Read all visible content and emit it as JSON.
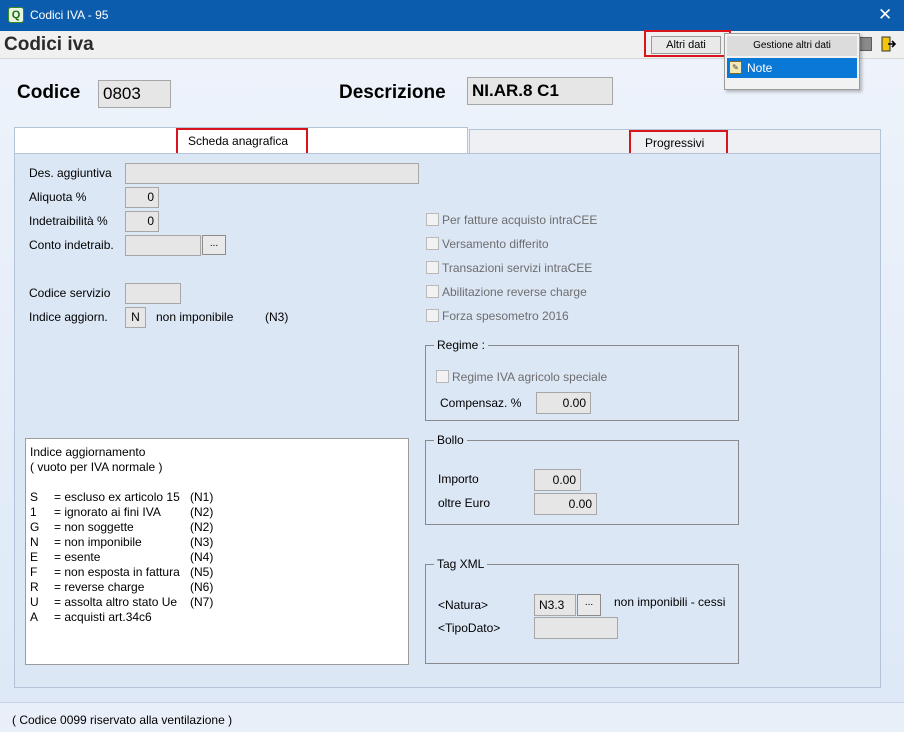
{
  "window": {
    "title": "Codici IVA - 95",
    "close_glyph": "✕",
    "app_icon": "Q"
  },
  "header": {
    "title": "Codici iva",
    "altri_dati_label": "Altri dati"
  },
  "popup_menu": {
    "header": "Gestione altri dati",
    "items": [
      {
        "label": "Note",
        "icon": "note-icon"
      }
    ]
  },
  "record": {
    "codice_label": "Codice",
    "codice_value": "0803",
    "descrizione_label": "Descrizione",
    "descrizione_value": "NI.AR.8 C1"
  },
  "tabs": [
    {
      "label": "Scheda anagrafica",
      "active": true
    },
    {
      "label": "Progressivi",
      "active": false
    }
  ],
  "form": {
    "des_aggiuntiva_label": "Des. aggiuntiva",
    "des_aggiuntiva_value": "",
    "aliquota_label": "Aliquota %",
    "aliquota_value": "0",
    "indetraibilita_label": "Indetraibilità %",
    "indetraibilita_value": "0",
    "conto_indetraib_label": "Conto indetraib.",
    "conto_indetraib_value": "",
    "ellipsis": "...",
    "codice_servizio_label": "Codice servizio",
    "codice_servizio_value": "",
    "indice_aggiorn_label": "Indice aggiorn.",
    "indice_aggiorn_value": "N",
    "indice_aggiorn_desc": "non imponibile",
    "indice_aggiorn_code": "(N3)"
  },
  "checkboxes": [
    {
      "label": "Per fatture acquisto intraCEE",
      "checked": false
    },
    {
      "label": "Versamento differito",
      "checked": false
    },
    {
      "label": "Transazioni servizi intraCEE",
      "checked": false
    },
    {
      "label": "Abilitazione reverse charge",
      "checked": false
    },
    {
      "label": "Forza spesometro 2016",
      "checked": false
    }
  ],
  "regime": {
    "title": "Regime :",
    "agricolo_label": "Regime IVA agricolo speciale",
    "compensaz_label": "Compensaz. %",
    "compensaz_value": "0.00"
  },
  "bollo": {
    "title": "Bollo",
    "importo_label": "Importo",
    "importo_value": "0.00",
    "oltre_label": "oltre Euro",
    "oltre_value": "0.00"
  },
  "tag_xml": {
    "title": "Tag XML",
    "natura_label": "<Natura>",
    "natura_value": "N3.3",
    "natura_desc": "non imponibili - cessi",
    "tipodato_label": "<TipoDato>",
    "tipodato_value": ""
  },
  "legend": {
    "title": "Indice aggiornamento",
    "subtitle": "( vuoto per IVA normale )",
    "rows": [
      {
        "k": "S",
        "d": "= escluso ex articolo 15",
        "c": "(N1)"
      },
      {
        "k": "1",
        "d": "= ignorato ai fini IVA",
        "c": "(N2)"
      },
      {
        "k": "G",
        "d": "= non soggette",
        "c": "(N2)"
      },
      {
        "k": "N",
        "d": "= non imponibile",
        "c": "(N3)"
      },
      {
        "k": "E",
        "d": "= esente",
        "c": "(N4)"
      },
      {
        "k": "F",
        "d": "= non esposta in fattura",
        "c": "(N5)"
      },
      {
        "k": "R",
        "d": "= reverse charge",
        "c": "(N6)"
      },
      {
        "k": "U",
        "d": "= assolta altro stato Ue",
        "c": "(N7)"
      },
      {
        "k": "A",
        "d": "= acquisti art.34c6",
        "c": ""
      }
    ]
  },
  "status": {
    "text": "( Codice 0099 riservato alla ventilazione )"
  },
  "colors": {
    "titlebar": "#0b5cad",
    "highlight": "#d8141c",
    "menu_selected": "#0a78d7",
    "panel": "#dce7f6"
  }
}
